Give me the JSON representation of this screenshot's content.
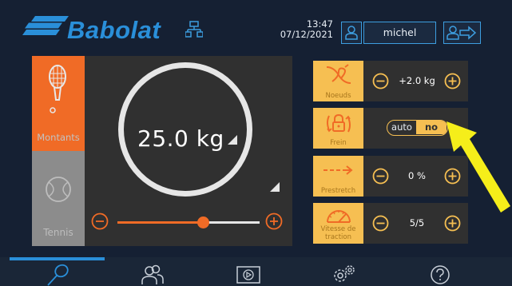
{
  "header": {
    "brand": "Babolat",
    "time": "13:47",
    "date": "07/12/2021",
    "username": "michel",
    "icons": {
      "network": "network-icon",
      "user": "user-icon",
      "logout": "logout-icon"
    }
  },
  "tension": {
    "value": "25.0 kg",
    "slider_fraction": 0.6,
    "tabs": {
      "strings": {
        "label": "Montants",
        "icon": "racket-icon",
        "active": true
      },
      "sport": {
        "label": "Tennis",
        "icon": "tennis-ball-icon",
        "active": false
      }
    }
  },
  "settings": {
    "knots": {
      "label": "Noeuds",
      "value": "+2.0 kg",
      "icon": "knot-icon"
    },
    "brake": {
      "label": "Frein",
      "icon": "lock-icon",
      "toggle_off_label": "auto",
      "toggle_on_label": "no",
      "selected": "no"
    },
    "prestretch": {
      "label": "Prestretch",
      "value": "0 %",
      "icon": "arrow-right-icon"
    },
    "speed": {
      "label": "Vitesse de traction",
      "value": "5/5",
      "icon": "speedometer-icon"
    }
  },
  "nav": {
    "items": [
      {
        "icon": "search-racket-icon",
        "active": true
      },
      {
        "icon": "users-icon",
        "active": false
      },
      {
        "icon": "play-icon",
        "active": false
      },
      {
        "icon": "gears-icon",
        "active": false
      },
      {
        "icon": "help-icon",
        "active": false
      }
    ]
  },
  "colors": {
    "accent_orange": "#f06b26",
    "accent_yellow": "#f6bf52",
    "brand_blue": "#2a8fd9",
    "background": "#152033",
    "annotation_arrow": "#f5ee1a"
  }
}
